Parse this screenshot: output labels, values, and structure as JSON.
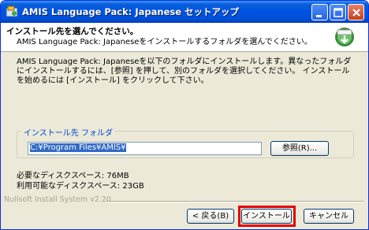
{
  "window": {
    "title": "AMIS Language Pack: Japanese セットアップ",
    "minimize_icon": "minimize-icon",
    "maximize_icon": "maximize-icon",
    "close_icon": "close-icon"
  },
  "header": {
    "title": "インストール先を選んでください。",
    "subtitle": "AMIS Language Pack: Japaneseをインストールするフォルダを選んでください。"
  },
  "description": "AMIS Language Pack: Japaneseを以下のフォルダにインストールします。異なったフォルダにインストールするには、[参照] を押して、別のフォルダを選択してください。 インストールを始めるには [インストール] をクリックして下さい。",
  "destination": {
    "group_label": "インストール先 フォルダ",
    "path": "C:¥Program Files¥AMIS¥",
    "browse_label": "参照(R)..."
  },
  "space": {
    "required": "必要なディスクスペース: 76MB",
    "available": "利用可能なディスクスペース: 23GB"
  },
  "footer": {
    "brand": "Nullsoft Install System v2.20",
    "back_label": "< 戻る(B)",
    "install_label": "インストール",
    "cancel_label": "キャンセル"
  },
  "colors": {
    "titlebar": "#0054e3",
    "highlight": "#e30000",
    "group_label": "#0046d5"
  }
}
